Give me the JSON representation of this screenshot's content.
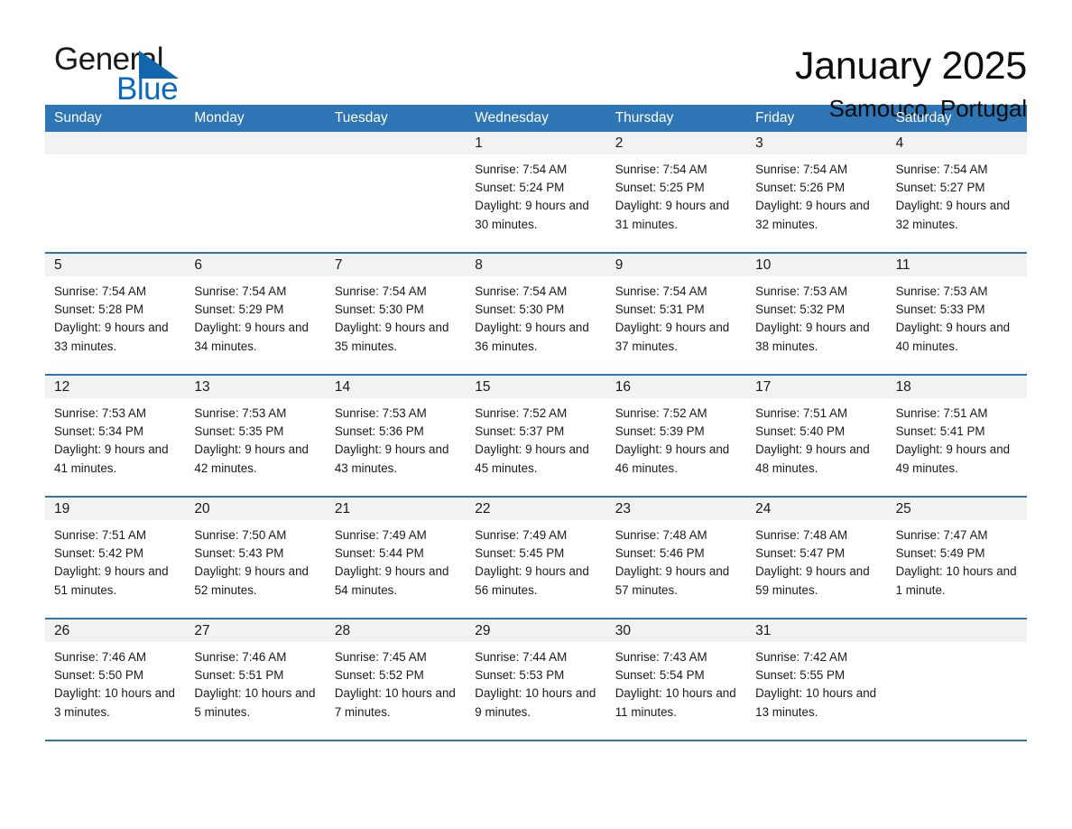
{
  "logo": {
    "text_primary": "General",
    "text_secondary": "Blue",
    "triangle_color": "#1266ad",
    "primary_color": "#1a1a1a",
    "secondary_color": "#0a69c0"
  },
  "header": {
    "title": "January 2025",
    "subtitle": "Samouco, Portugal"
  },
  "theme": {
    "header_bg": "#2E75B6",
    "header_text": "#ffffff",
    "daynum_bg": "#F2F2F2",
    "cell_bg": "#ffffff",
    "separator": "#2E75B6"
  },
  "weekdays": [
    "Sunday",
    "Monday",
    "Tuesday",
    "Wednesday",
    "Thursday",
    "Friday",
    "Saturday"
  ],
  "weeks": [
    [
      {
        "day": "",
        "sunrise": "",
        "sunset": "",
        "daylight": "",
        "empty": true
      },
      {
        "day": "",
        "sunrise": "",
        "sunset": "",
        "daylight": "",
        "empty": true
      },
      {
        "day": "",
        "sunrise": "",
        "sunset": "",
        "daylight": "",
        "empty": true
      },
      {
        "day": "1",
        "sunrise": "Sunrise: 7:54 AM",
        "sunset": "Sunset: 5:24 PM",
        "daylight": "Daylight: 9 hours and 30 minutes."
      },
      {
        "day": "2",
        "sunrise": "Sunrise: 7:54 AM",
        "sunset": "Sunset: 5:25 PM",
        "daylight": "Daylight: 9 hours and 31 minutes."
      },
      {
        "day": "3",
        "sunrise": "Sunrise: 7:54 AM",
        "sunset": "Sunset: 5:26 PM",
        "daylight": "Daylight: 9 hours and 32 minutes."
      },
      {
        "day": "4",
        "sunrise": "Sunrise: 7:54 AM",
        "sunset": "Sunset: 5:27 PM",
        "daylight": "Daylight: 9 hours and 32 minutes."
      }
    ],
    [
      {
        "day": "5",
        "sunrise": "Sunrise: 7:54 AM",
        "sunset": "Sunset: 5:28 PM",
        "daylight": "Daylight: 9 hours and 33 minutes."
      },
      {
        "day": "6",
        "sunrise": "Sunrise: 7:54 AM",
        "sunset": "Sunset: 5:29 PM",
        "daylight": "Daylight: 9 hours and 34 minutes."
      },
      {
        "day": "7",
        "sunrise": "Sunrise: 7:54 AM",
        "sunset": "Sunset: 5:30 PM",
        "daylight": "Daylight: 9 hours and 35 minutes."
      },
      {
        "day": "8",
        "sunrise": "Sunrise: 7:54 AM",
        "sunset": "Sunset: 5:30 PM",
        "daylight": "Daylight: 9 hours and 36 minutes."
      },
      {
        "day": "9",
        "sunrise": "Sunrise: 7:54 AM",
        "sunset": "Sunset: 5:31 PM",
        "daylight": "Daylight: 9 hours and 37 minutes."
      },
      {
        "day": "10",
        "sunrise": "Sunrise: 7:53 AM",
        "sunset": "Sunset: 5:32 PM",
        "daylight": "Daylight: 9 hours and 38 minutes."
      },
      {
        "day": "11",
        "sunrise": "Sunrise: 7:53 AM",
        "sunset": "Sunset: 5:33 PM",
        "daylight": "Daylight: 9 hours and 40 minutes."
      }
    ],
    [
      {
        "day": "12",
        "sunrise": "Sunrise: 7:53 AM",
        "sunset": "Sunset: 5:34 PM",
        "daylight": "Daylight: 9 hours and 41 minutes."
      },
      {
        "day": "13",
        "sunrise": "Sunrise: 7:53 AM",
        "sunset": "Sunset: 5:35 PM",
        "daylight": "Daylight: 9 hours and 42 minutes."
      },
      {
        "day": "14",
        "sunrise": "Sunrise: 7:53 AM",
        "sunset": "Sunset: 5:36 PM",
        "daylight": "Daylight: 9 hours and 43 minutes."
      },
      {
        "day": "15",
        "sunrise": "Sunrise: 7:52 AM",
        "sunset": "Sunset: 5:37 PM",
        "daylight": "Daylight: 9 hours and 45 minutes."
      },
      {
        "day": "16",
        "sunrise": "Sunrise: 7:52 AM",
        "sunset": "Sunset: 5:39 PM",
        "daylight": "Daylight: 9 hours and 46 minutes."
      },
      {
        "day": "17",
        "sunrise": "Sunrise: 7:51 AM",
        "sunset": "Sunset: 5:40 PM",
        "daylight": "Daylight: 9 hours and 48 minutes."
      },
      {
        "day": "18",
        "sunrise": "Sunrise: 7:51 AM",
        "sunset": "Sunset: 5:41 PM",
        "daylight": "Daylight: 9 hours and 49 minutes."
      }
    ],
    [
      {
        "day": "19",
        "sunrise": "Sunrise: 7:51 AM",
        "sunset": "Sunset: 5:42 PM",
        "daylight": "Daylight: 9 hours and 51 minutes."
      },
      {
        "day": "20",
        "sunrise": "Sunrise: 7:50 AM",
        "sunset": "Sunset: 5:43 PM",
        "daylight": "Daylight: 9 hours and 52 minutes."
      },
      {
        "day": "21",
        "sunrise": "Sunrise: 7:49 AM",
        "sunset": "Sunset: 5:44 PM",
        "daylight": "Daylight: 9 hours and 54 minutes."
      },
      {
        "day": "22",
        "sunrise": "Sunrise: 7:49 AM",
        "sunset": "Sunset: 5:45 PM",
        "daylight": "Daylight: 9 hours and 56 minutes."
      },
      {
        "day": "23",
        "sunrise": "Sunrise: 7:48 AM",
        "sunset": "Sunset: 5:46 PM",
        "daylight": "Daylight: 9 hours and 57 minutes."
      },
      {
        "day": "24",
        "sunrise": "Sunrise: 7:48 AM",
        "sunset": "Sunset: 5:47 PM",
        "daylight": "Daylight: 9 hours and 59 minutes."
      },
      {
        "day": "25",
        "sunrise": "Sunrise: 7:47 AM",
        "sunset": "Sunset: 5:49 PM",
        "daylight": "Daylight: 10 hours and 1 minute."
      }
    ],
    [
      {
        "day": "26",
        "sunrise": "Sunrise: 7:46 AM",
        "sunset": "Sunset: 5:50 PM",
        "daylight": "Daylight: 10 hours and 3 minutes."
      },
      {
        "day": "27",
        "sunrise": "Sunrise: 7:46 AM",
        "sunset": "Sunset: 5:51 PM",
        "daylight": "Daylight: 10 hours and 5 minutes."
      },
      {
        "day": "28",
        "sunrise": "Sunrise: 7:45 AM",
        "sunset": "Sunset: 5:52 PM",
        "daylight": "Daylight: 10 hours and 7 minutes."
      },
      {
        "day": "29",
        "sunrise": "Sunrise: 7:44 AM",
        "sunset": "Sunset: 5:53 PM",
        "daylight": "Daylight: 10 hours and 9 minutes."
      },
      {
        "day": "30",
        "sunrise": "Sunrise: 7:43 AM",
        "sunset": "Sunset: 5:54 PM",
        "daylight": "Daylight: 10 hours and 11 minutes."
      },
      {
        "day": "31",
        "sunrise": "Sunrise: 7:42 AM",
        "sunset": "Sunset: 5:55 PM",
        "daylight": "Daylight: 10 hours and 13 minutes."
      },
      {
        "day": "",
        "sunrise": "",
        "sunset": "",
        "daylight": "",
        "empty": true
      }
    ]
  ]
}
